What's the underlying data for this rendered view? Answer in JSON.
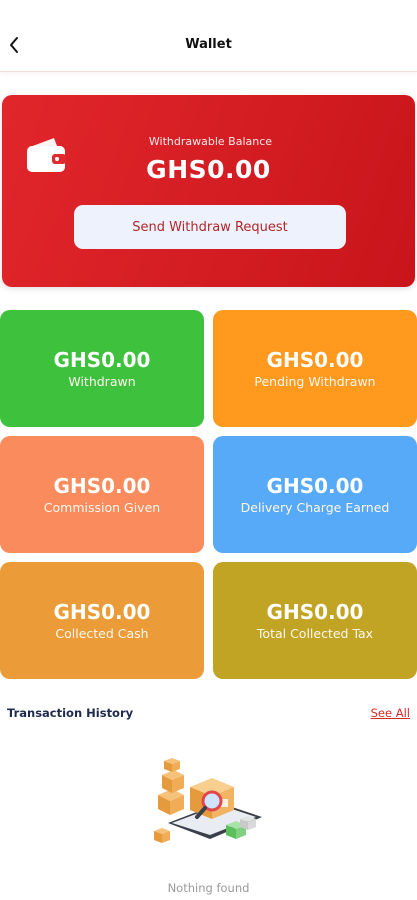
{
  "app_bar": {
    "title": "Wallet",
    "back_icon": "chevron-left-icon"
  },
  "balance": {
    "label": "Withdrawable Balance",
    "amount": "GHS0.00",
    "button_label": "Send Withdraw Request",
    "icon": "wallet-icon",
    "card_color": "#d9222a"
  },
  "stats": [
    {
      "amount": "GHS0.00",
      "label": "Withdrawn",
      "color": "#3ec23e"
    },
    {
      "amount": "GHS0.00",
      "label": "Pending Withdrawn",
      "color": "#ff9a1f"
    },
    {
      "amount": "GHS0.00",
      "label": "Commission Given",
      "color": "#fa8b5c"
    },
    {
      "amount": "GHS0.00",
      "label": "Delivery Charge Earned",
      "color": "#56aaf7"
    },
    {
      "amount": "GHS0.00",
      "label": "Collected Cash",
      "color": "#eb9c38"
    },
    {
      "amount": "GHS0.00",
      "label": "Total Collected Tax",
      "color": "#c1a424"
    }
  ],
  "history": {
    "title": "Transaction History",
    "see_all": "See All",
    "empty_text": "Nothing found",
    "empty_icon": "empty-boxes-illustration"
  }
}
